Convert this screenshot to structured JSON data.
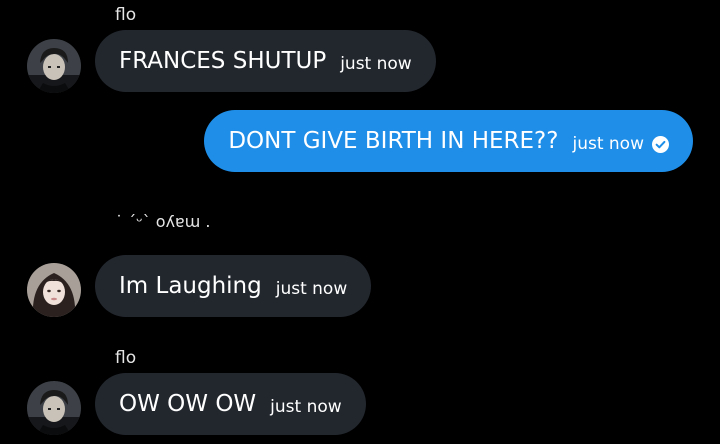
{
  "messages": [
    {
      "sender": "flo",
      "text": "FRANCES SHUTUP",
      "time": "just now",
      "direction": "incoming"
    },
    {
      "text": "DONT GIVE BIRTH IN HERE??",
      "time": "just now",
      "direction": "outgoing",
      "status_icon": "check-circle-icon"
    },
    {
      "sender": "˙ ´ᵕ` ᴏʎɐɯ .",
      "text": "Im Laughing",
      "time": "just now",
      "direction": "incoming"
    },
    {
      "sender": "flo",
      "text": "OW OW OW",
      "time": "just now",
      "direction": "incoming"
    }
  ],
  "colors": {
    "background": "#000000",
    "incoming_bubble": "#22272e",
    "outgoing_bubble": "#1e8ee8",
    "text": "#ffffff"
  }
}
